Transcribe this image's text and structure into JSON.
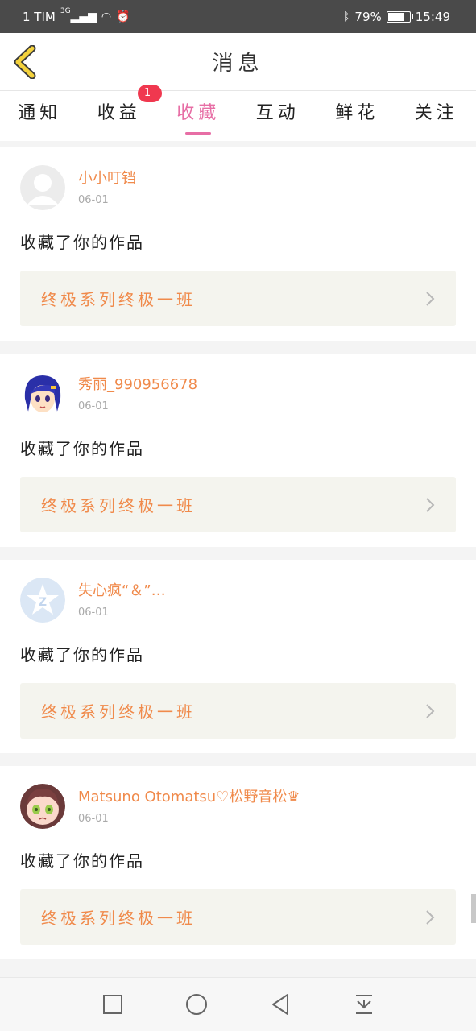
{
  "status_bar": {
    "carrier": "1 TIM",
    "network": "3G",
    "battery": "79%",
    "battery_level": 0.79,
    "time": "15:49"
  },
  "header": {
    "title": "消息",
    "back_icon": "chevron-left-icon"
  },
  "tabs": [
    {
      "label": "通知",
      "active": false
    },
    {
      "label": "收益",
      "active": false,
      "badge": "1"
    },
    {
      "label": "收藏",
      "active": true
    },
    {
      "label": "互动",
      "active": false
    },
    {
      "label": "鲜花",
      "active": false
    },
    {
      "label": "关注",
      "active": false
    }
  ],
  "notifications": [
    {
      "username": "小小叮铛",
      "date": "06-01",
      "action": "收藏了你的作品",
      "work": "终极系列终极一班",
      "avatar": "default-avatar"
    },
    {
      "username": "秀丽_990956678",
      "date": "06-01",
      "action": "收藏了你的作品",
      "work": "终极系列终极一班",
      "avatar": "anime-girl-blue-hair-avatar"
    },
    {
      "username": "失心疯“＆”…",
      "date": "06-01",
      "action": "收藏了你的作品",
      "work": "终极系列终极一班",
      "avatar": "qzone-star-avatar"
    },
    {
      "username": "Matsuno Otomatsu♡松野音松♛",
      "date": "06-01",
      "action": "收藏了你的作品",
      "work": "终极系列终极一班",
      "avatar": "anime-face-avatar"
    }
  ],
  "nav_bar": {
    "icons": [
      "square-recent-icon",
      "circle-home-icon",
      "triangle-back-icon",
      "pull-down-icon"
    ]
  },
  "colors": {
    "accent_pink": "#e76ea5",
    "username_orange": "#f08a4b",
    "badge_red": "#f0384f",
    "back_yellow": "#f4d23c"
  }
}
